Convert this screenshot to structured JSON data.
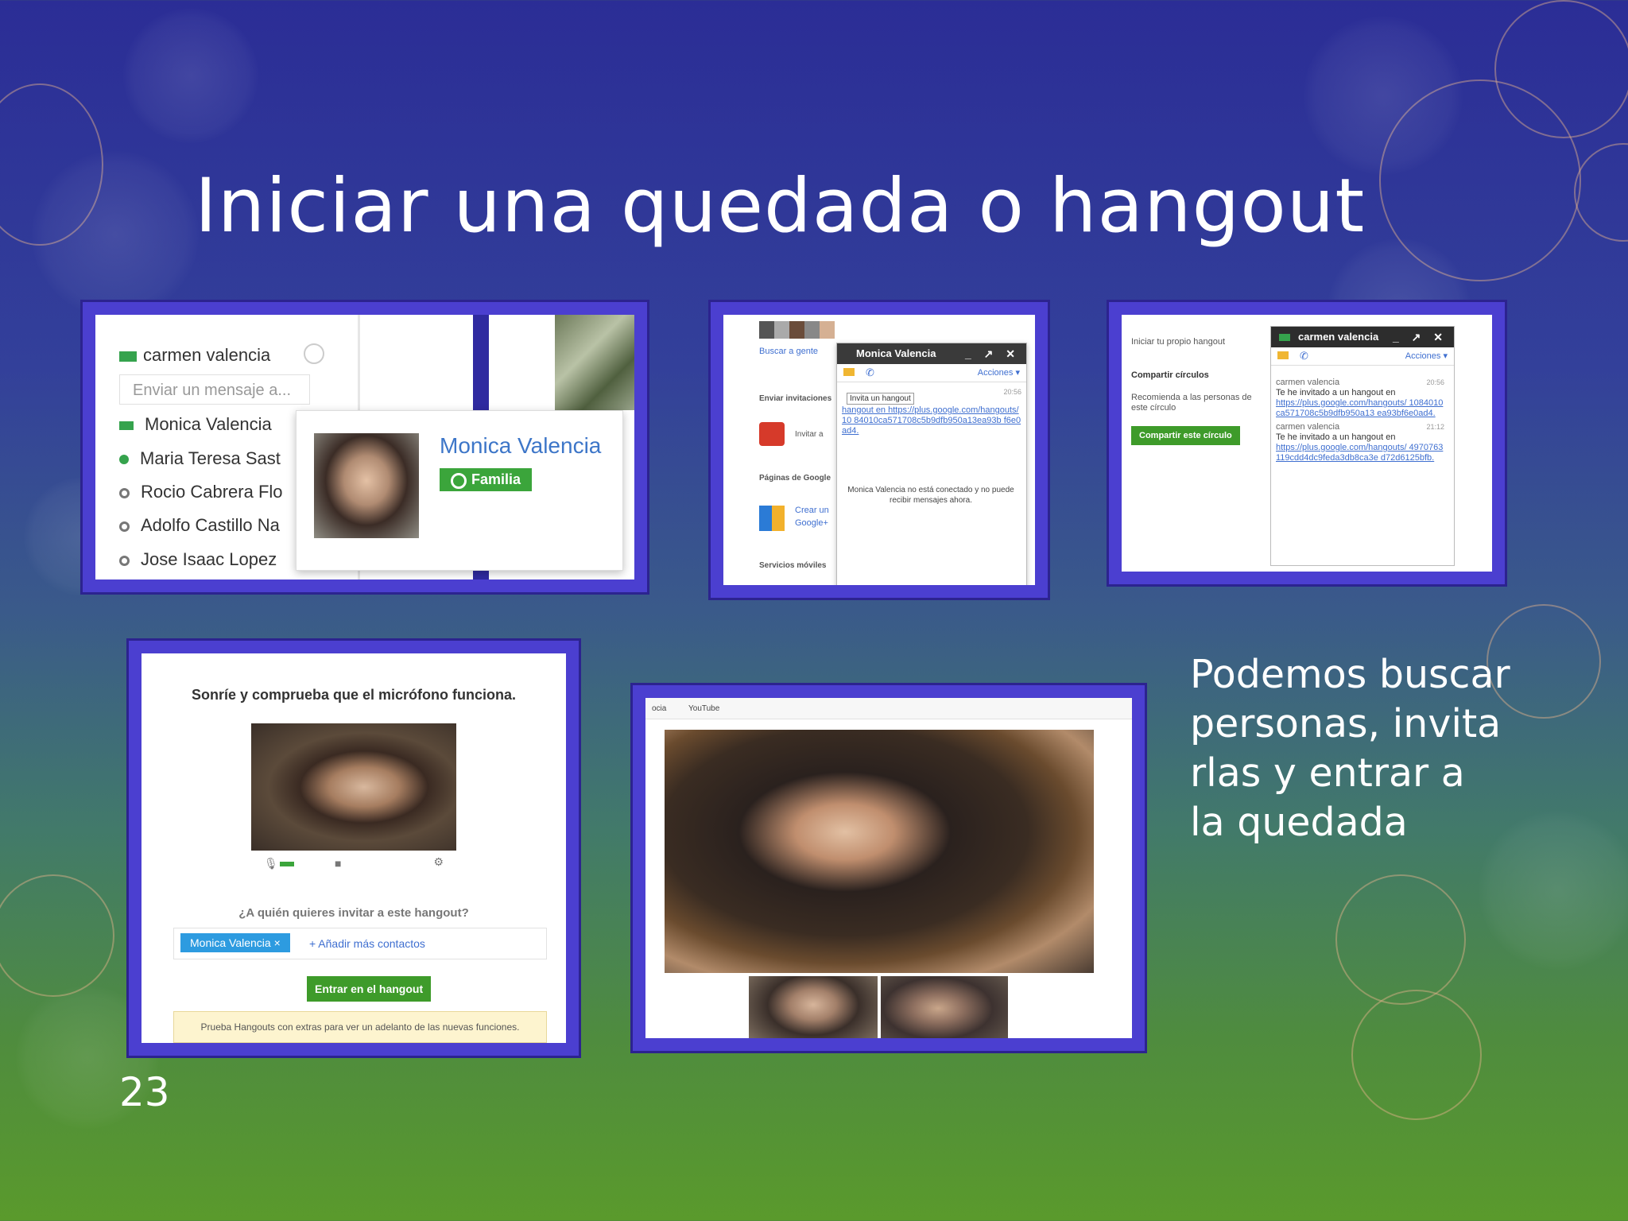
{
  "slide": {
    "title": "Iniciar una quedada o hangout",
    "side_text": "Podemos buscar\npersonas, invita\nrlas y entrar a\nla quedada",
    "page_number": "23"
  },
  "screenshot1": {
    "current_user": "carmen valencia",
    "message_placeholder": "Enviar un mensaje a...",
    "contacts": [
      {
        "name": "Monica Valencia",
        "status_color": "#35a34d"
      },
      {
        "name": "Maria Teresa Sast",
        "status_color": "#35a34d"
      },
      {
        "name": "Rocio Cabrera Flo",
        "status_color": "#777777"
      },
      {
        "name": "Adolfo Castillo Na",
        "status_color": "#777777"
      },
      {
        "name": "Jose Isaac Lopez",
        "status_color": "#777777"
      }
    ],
    "card_name": "Monica Valencia",
    "card_circle": "Familia"
  },
  "screenshot2": {
    "search_label": "Buscar a gente",
    "send_invites": "Enviar invitaciones",
    "invite": "Invitar a",
    "google_pages": "Páginas de Google",
    "create": "Crear un",
    "google_plus": "Google+",
    "mobile_services": "Servicios móviles",
    "chat_title": "Monica Valencia",
    "actions": "Acciones ▾",
    "tooltip": "Invita un hangout",
    "time": "20:56",
    "message": "hangout en https://plus.google.com/hangouts/10 84010ca571708c5b9dfb950a13ea93b f6e0ad4.",
    "offline": "Monica Valencia no está conectado y no puede recibir mensajes ahora."
  },
  "screenshot3": {
    "start_own": "Iniciar tu propio hangout",
    "share_circles": "Compartir círculos",
    "recommend": "Recomienda a las personas de este círculo",
    "share_button": "Compartir este círculo",
    "chat_title": "carmen valencia",
    "actions": "Acciones ▾",
    "msg1_author": "carmen valencia",
    "msg1_time": "20:56",
    "msg1_text": "Te he invitado a un hangout en",
    "msg1_link": "https://plus.google.com/hangouts/ 1084010ca571708c5b9dfb950a13 ea93bf6e0ad4.",
    "msg2_author": "carmen valencia",
    "msg2_time": "21:12",
    "msg2_text": "Te he invitado a un hangout en",
    "msg2_link": "https://plus.google.com/hangouts/ 4970763119cdd4dc9feda3db8ca3e d72d6125bfb."
  },
  "screenshot4": {
    "title": "Sonríe y comprueba que el micrófono funciona.",
    "question": "¿A quién quieres invitar a este hangout?",
    "chip": "Monica Valencia ×",
    "add_contacts": "+ Añadir más contactos",
    "enter_button": "Entrar en el hangout",
    "note": "Prueba Hangouts con extras para ver un adelanto de las nuevas funciones."
  },
  "screenshot5": {
    "tab1": "ocia",
    "tab2": "YouTube"
  }
}
